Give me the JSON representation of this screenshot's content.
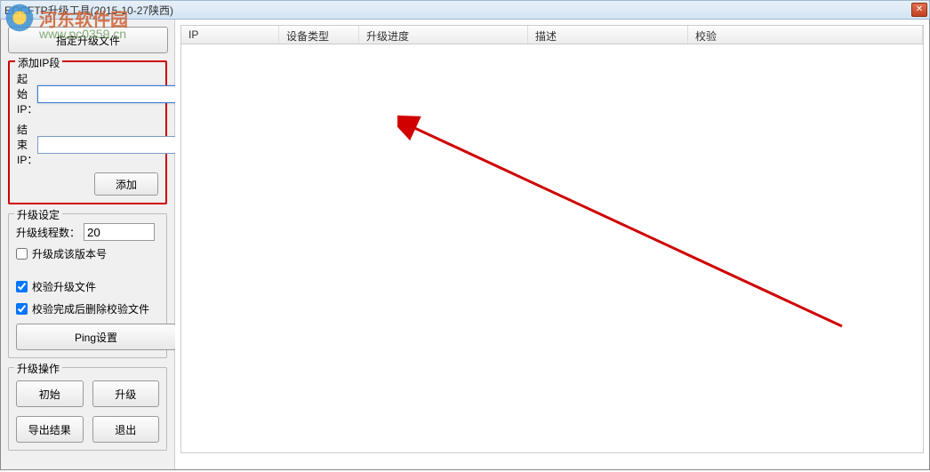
{
  "window": {
    "title": "EOCFTP升级工具(2015-10-27陕西)"
  },
  "watermark": {
    "text": "河东软件园",
    "url": "www.pc0359.cn"
  },
  "sidebar": {
    "specify_file_btn": "指定升级文件",
    "ip_section": {
      "title": "添加IP段",
      "start_label": "起始IP：",
      "end_label": "结束IP：",
      "start_value": "",
      "end_value": "",
      "add_btn": "添加"
    },
    "upgrade_settings": {
      "title": "升级设定",
      "threads_label": "升级线程数：",
      "threads_value": "20",
      "checkbox1_label": "升级成该版本号",
      "checkbox1_checked": false,
      "checkbox2_label": "校验升级文件",
      "checkbox2_checked": true,
      "checkbox3_label": "校验完成后删除校验文件",
      "checkbox3_checked": true,
      "ping_btn": "Ping设置"
    },
    "operations": {
      "title": "升级操作",
      "init_btn": "初始",
      "upgrade_btn": "升级",
      "export_btn": "导出结果",
      "exit_btn": "退出"
    }
  },
  "table": {
    "columns": {
      "ip": "IP",
      "device_type": "设备类型",
      "progress": "升级进度",
      "description": "描述",
      "verify": "校验"
    }
  }
}
